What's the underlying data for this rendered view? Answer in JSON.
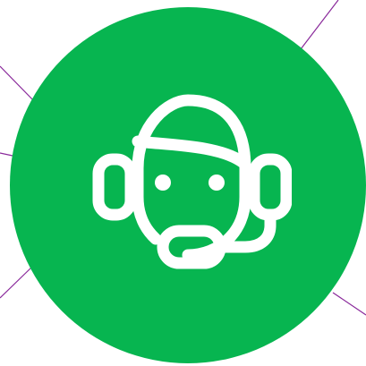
{
  "colors": {
    "circle_fill": "#07b550",
    "icon_stroke": "#ffffff",
    "connector_line": "#8a2a9b"
  },
  "icon": {
    "name": "customer-support-headset-icon"
  }
}
